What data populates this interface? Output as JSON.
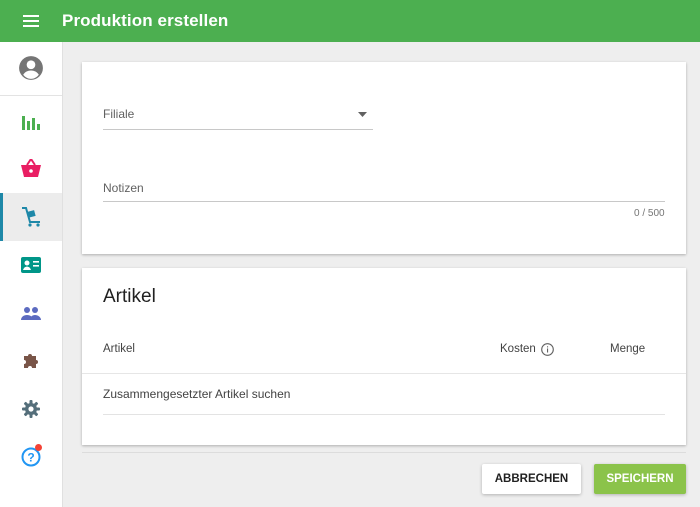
{
  "header": {
    "title": "Produktion erstellen"
  },
  "sidebar": {
    "items": [
      {
        "icon": "account-circle-icon"
      },
      {
        "icon": "bar-chart-icon",
        "color": "#4caf50"
      },
      {
        "icon": "shopping-basket-icon",
        "color": "#e91e63"
      },
      {
        "icon": "cart-production-icon",
        "color": "#1e88a8",
        "active": true
      },
      {
        "icon": "contact-card-icon",
        "color": "#009688"
      },
      {
        "icon": "people-icon",
        "color": "#5c6bc0"
      },
      {
        "icon": "puzzle-icon",
        "color": "#795548"
      },
      {
        "icon": "gear-icon",
        "color": "#546e7a"
      },
      {
        "icon": "help-icon",
        "color": "#2196f3",
        "badge": true
      }
    ]
  },
  "form": {
    "filiale_label": "Filiale",
    "notizen_label": "Notizen",
    "notizen_counter": "0 / 500"
  },
  "artikel": {
    "title": "Artikel",
    "columns": {
      "artikel": "Artikel",
      "kosten": "Kosten",
      "menge": "Menge"
    },
    "search_placeholder": "Zusammengesetzter Artikel suchen"
  },
  "actions": {
    "cancel": "ABBRECHEN",
    "save": "SPEICHERN"
  },
  "colors": {
    "topbar": "#4caf50",
    "save": "#8bc34a",
    "active": "#1e88a8",
    "badge": "#f44336"
  }
}
